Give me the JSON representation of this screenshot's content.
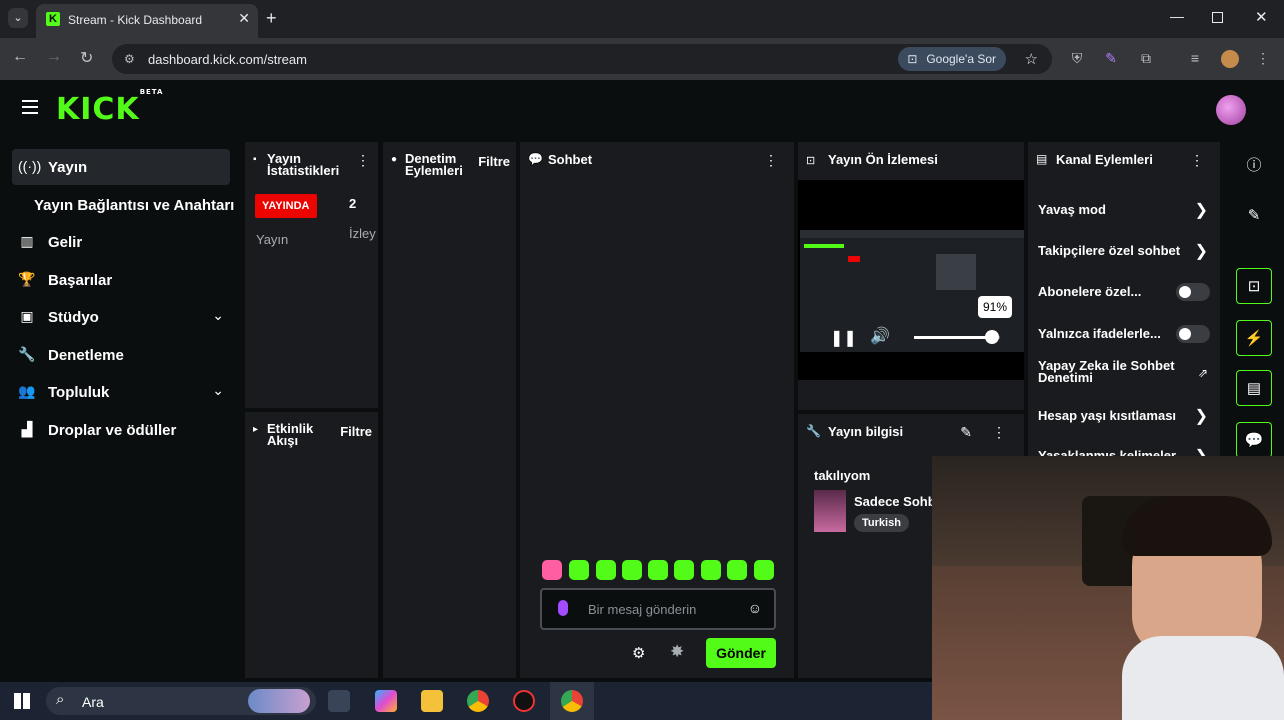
{
  "browser": {
    "tab_title": "Stream - Kick Dashboard",
    "url": "dashboard.kick.com/stream",
    "google_sor": "Google'a Sor"
  },
  "app": {
    "logo": "KICK",
    "logo_beta": "BETA"
  },
  "sidebar": {
    "items": [
      {
        "label": "Yayın",
        "icon": "broadcast-icon"
      },
      {
        "label": "Yayın Bağlantısı ve Anahtarı"
      },
      {
        "label": "Gelir",
        "icon": "chart-icon"
      },
      {
        "label": "Başarılar",
        "icon": "trophy-icon"
      },
      {
        "label": "Stüdyo",
        "icon": "studio-icon"
      },
      {
        "label": "Denetleme",
        "icon": "wrench-icon"
      },
      {
        "label": "Topluluk",
        "icon": "community-icon"
      },
      {
        "label": "Droplar ve ödüller",
        "icon": "drops-icon"
      }
    ]
  },
  "stats": {
    "title_line1": "Yayın",
    "title_line2": "İstatistikleri",
    "live_badge": "YAYINDA",
    "live_label": "Yayın",
    "viewer_count": "2",
    "viewer_label": "İzley"
  },
  "mod_actions": {
    "title_line1": "Denetim",
    "title_line2": "Eylemleri",
    "filter": "Filtre"
  },
  "activity": {
    "title_line1": "Etkinlik",
    "title_line2": "Akışı",
    "filter": "Filtre"
  },
  "chat": {
    "title": "Sohbet",
    "placeholder": "Bir mesaj gönderin",
    "send": "Gönder"
  },
  "preview": {
    "title": "Yayın Ön İzlemesi",
    "volume_tooltip": "91%",
    "volume": 0.91
  },
  "stream_info": {
    "title": "Yayın bilgisi",
    "stream_title": "takılıyom",
    "category": "Sadece Sohbet",
    "language": "Turkish"
  },
  "channel_actions": {
    "title": "Kanal Eylemleri",
    "items": [
      {
        "label": "Yavaş mod"
      },
      {
        "label": "Takipçilere özel sohbet"
      },
      {
        "label": "Abonelere özel..."
      },
      {
        "label": "Yalnızca ifadelerle..."
      },
      {
        "label_line1": "Yapay Zeka ile Sohbet",
        "label_line2": "Denetimi"
      },
      {
        "label": "Hesap yaşı kısıtlaması"
      },
      {
        "label": "Yasaklanmış kelimeler"
      }
    ]
  },
  "taskbar": {
    "search": "Ara"
  }
}
